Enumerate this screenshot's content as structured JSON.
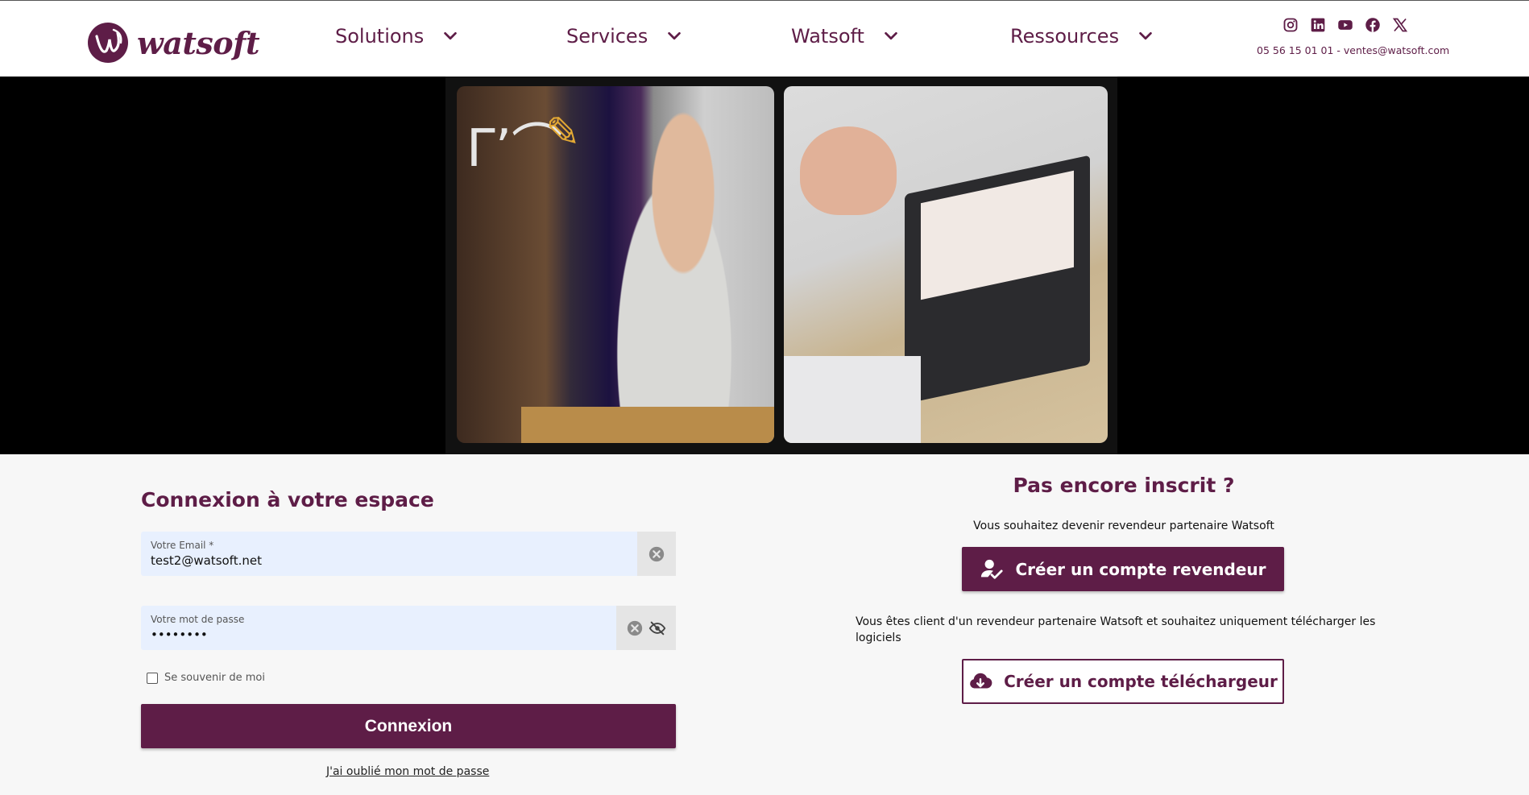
{
  "brand": {
    "name": "watsoft",
    "color": "#5e1d47"
  },
  "nav": [
    {
      "label": "Solutions"
    },
    {
      "label": "Services"
    },
    {
      "label": "Watsoft"
    },
    {
      "label": "Ressources"
    }
  ],
  "socials": [
    "instagram-icon",
    "linkedin-icon",
    "youtube-icon",
    "facebook-icon",
    "x-icon"
  ],
  "contact": "05 56 15 01 01 - ventes@watsoft.com",
  "login": {
    "title": "Connexion à votre espace",
    "email_label": "Votre Email *",
    "email_value": "test2@watsoft.net",
    "password_label": "Votre mot de passe",
    "password_value": "••••••••",
    "remember": "Se souvenir de moi",
    "submit": "Connexion",
    "forgot": "J'ai oublié mon mot de passe"
  },
  "register": {
    "title": "Pas encore inscrit ?",
    "reseller_text": "Vous souhaitez devenir revendeur partenaire Watsoft",
    "reseller_button": "Créer un compte revendeur",
    "client_text": "Vous êtes client d'un revendeur partenaire Watsoft et souhaitez uniquement télécharger les logiciels",
    "download_button": "Créer un compte téléchargeur"
  }
}
